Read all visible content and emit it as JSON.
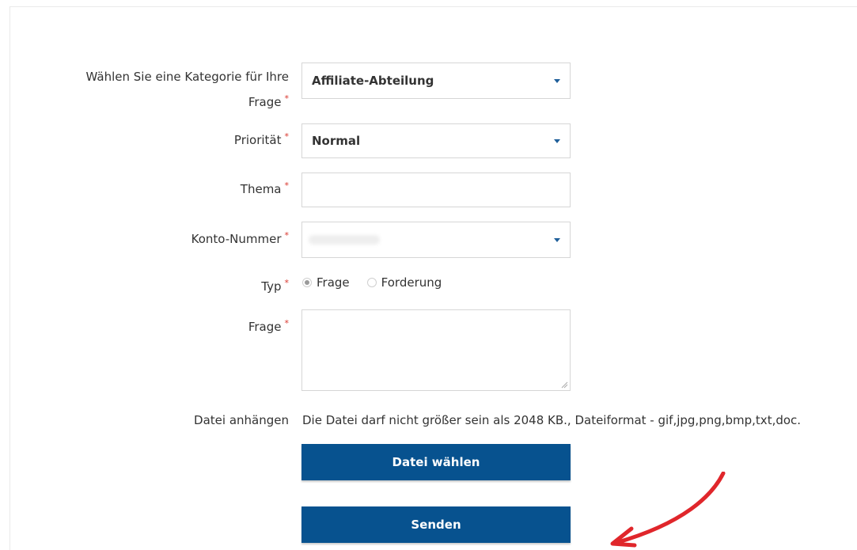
{
  "form": {
    "category": {
      "label": "Wählen Sie eine Kategorie für Ihre",
      "label_line2": "Frage",
      "value": "Affiliate-Abteilung"
    },
    "priority": {
      "label": "Priorität",
      "value": "Normal"
    },
    "subject": {
      "label": "Thema",
      "value": ""
    },
    "account": {
      "label": "Konto-Nummer",
      "value": ""
    },
    "type": {
      "label": "Typ",
      "options": [
        "Frage",
        "Forderung"
      ],
      "selected": "Frage"
    },
    "question": {
      "label": "Frage",
      "value": ""
    },
    "attachment": {
      "label": "Datei anhängen",
      "hint": "Die Datei darf nicht größer sein als 2048 KB., Dateiformat - gif,jpg,png,bmp,txt,doc.",
      "button_label": "Datei wählen"
    },
    "required_marker": "*",
    "submit_label": "Senden"
  },
  "colors": {
    "button_bg": "#07528f",
    "required": "#d9372e",
    "caret": "#1f5f9a",
    "annotation_arrow": "#e0262b"
  }
}
